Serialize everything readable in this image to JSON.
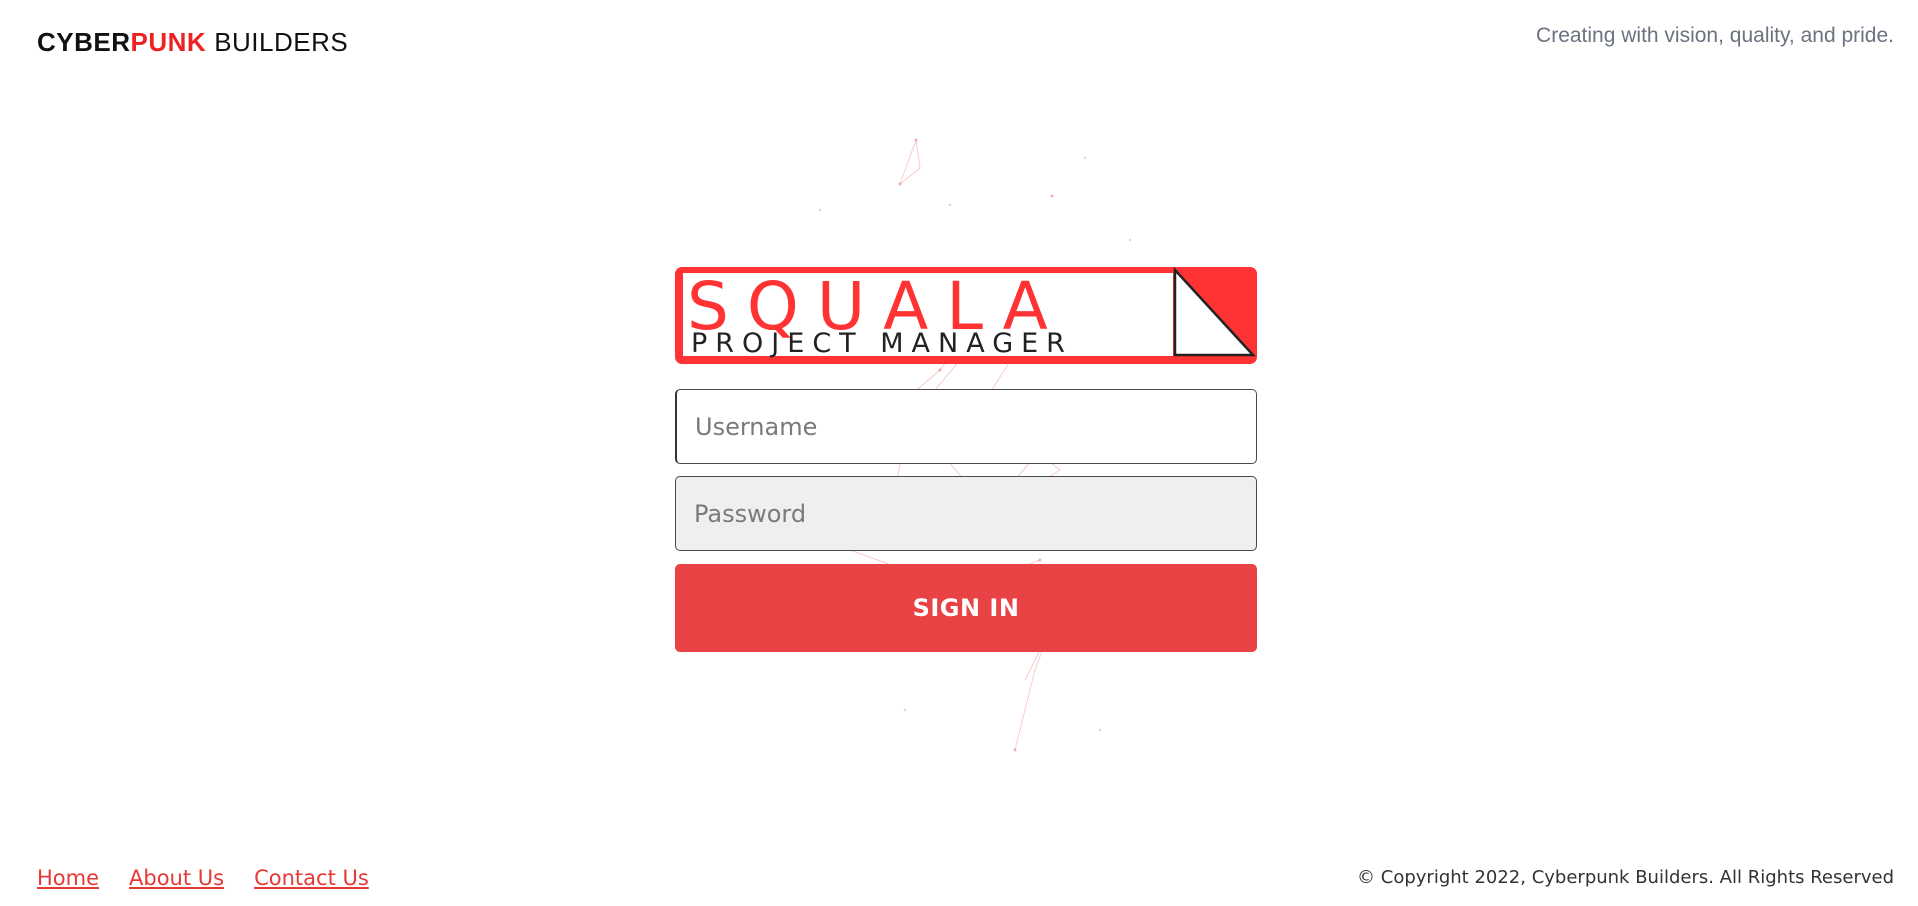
{
  "header": {
    "brand_part1": "CYBER",
    "brand_part2": "PUNK",
    "brand_part3": "BUILDERS",
    "tagline": "Creating with vision, quality, and pride."
  },
  "logo": {
    "title": "SQUALA",
    "subtitle": "PROJECT MANAGER"
  },
  "form": {
    "username_placeholder": "Username",
    "username_value": "",
    "password_placeholder": "Password",
    "password_value": "",
    "signin_label": "SIGN IN"
  },
  "footer": {
    "links": [
      "Home",
      "About Us",
      "Contact Us"
    ],
    "copyright": "© Copyright 2022, Cyberpunk Builders. All Rights Reserved"
  },
  "colors": {
    "accent": "#e84245",
    "brand_red": "#ee2222",
    "tagline_gray": "#6b7280"
  }
}
